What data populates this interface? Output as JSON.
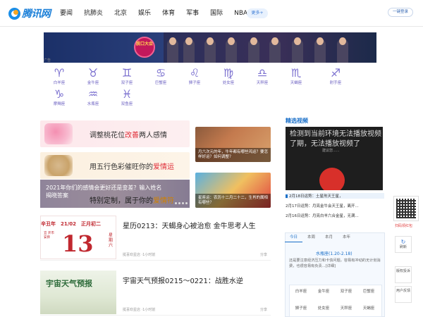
{
  "header": {
    "logo_text": "腾讯网",
    "nav": [
      "要闻",
      "抗肺炎",
      "北京",
      "娱乐",
      "体育",
      "军事",
      "国际",
      "NBA"
    ],
    "more_label": "更多",
    "login_label": "一键登录"
  },
  "banner": {
    "badge": "脱口大会",
    "caption": "广告"
  },
  "zodiac": [
    {
      "symbol": "♈",
      "name": "白羊座"
    },
    {
      "symbol": "♉",
      "name": "金牛座"
    },
    {
      "symbol": "♊",
      "name": "双子座"
    },
    {
      "symbol": "♋",
      "name": "巨蟹座"
    },
    {
      "symbol": "♌",
      "name": "狮子座"
    },
    {
      "symbol": "♍",
      "name": "处女座"
    },
    {
      "symbol": "♎",
      "name": "天秤座"
    },
    {
      "symbol": "♏",
      "name": "天蝎座"
    },
    {
      "symbol": "♐",
      "name": "射手座"
    },
    {
      "symbol": "♑",
      "name": "摩羯座"
    },
    {
      "symbol": "♒",
      "name": "水瓶座"
    },
    {
      "symbol": "♓",
      "name": "双鱼座"
    }
  ],
  "cards": [
    {
      "pre": "调整桃花位",
      "hl": "改善",
      "post": "两人感情"
    },
    {
      "pre": "用五行色彩催旺你的",
      "hl": "爱情运",
      "post": ""
    }
  ],
  "photo_big": {
    "title_line1": "2021年你们的感情会更好还是变差？输入姓名",
    "title_line2": "揭晓答案",
    "sub_pre": "特别定制，属于你的",
    "sub_hl": "爱情符"
  },
  "thumbs": [
    "月六次元的年，牛年都有哪些鸿运？要怎样好运？如何调整？",
    "星座运：农历十二月二十二，生肖的属相有哪些？"
  ],
  "articles": [
    {
      "title": "星历0213：天蝎身心被治愈 金牛思考人生",
      "meta": "挺喜欢星店 ·1小时前",
      "share": "分享",
      "cal_head": "辛丑年　21/02　正月初二",
      "cal_day": "13",
      "cal_left": "宜 开市 安葬",
      "cal_right": "星期六"
    },
    {
      "title": "宇宙天气预报0215～0221：战胜水逆",
      "meta": "挺喜欢星店 ·1小时前",
      "share": "分享",
      "art_caption": "宇宙天气预报"
    }
  ],
  "right": {
    "video_heading": "精选视频",
    "video_text": "检测到当前环境无法播放视频了期，无法播放视频了",
    "video_sub": "建议您......",
    "video_list": [
      "2月18日运势：土星刑天王星，",
      "2月17日运势：月亮金牛会天王星，离开...",
      "2月16日运势：月亮白羊六合金星，无满..."
    ],
    "horoscope_tabs": [
      "今日",
      "本周",
      "本月",
      "本年"
    ],
    "sign": "水瓶座(1.20-2.18)",
    "sign_text": "还是要注意经济压力和卡债问题，容易有冲动的无计划消费，也很容易有负责...[详细]",
    "grid": [
      "白羊座",
      "金牛座",
      "双子座",
      "巨蟹座",
      "狮子座",
      "处女座",
      "天秤座",
      "天蝎座"
    ]
  },
  "side": {
    "qr_caption": "扫码领红包",
    "refresh": "刷新",
    "copyright": "版权投诉",
    "feedback": "用户反馈"
  }
}
